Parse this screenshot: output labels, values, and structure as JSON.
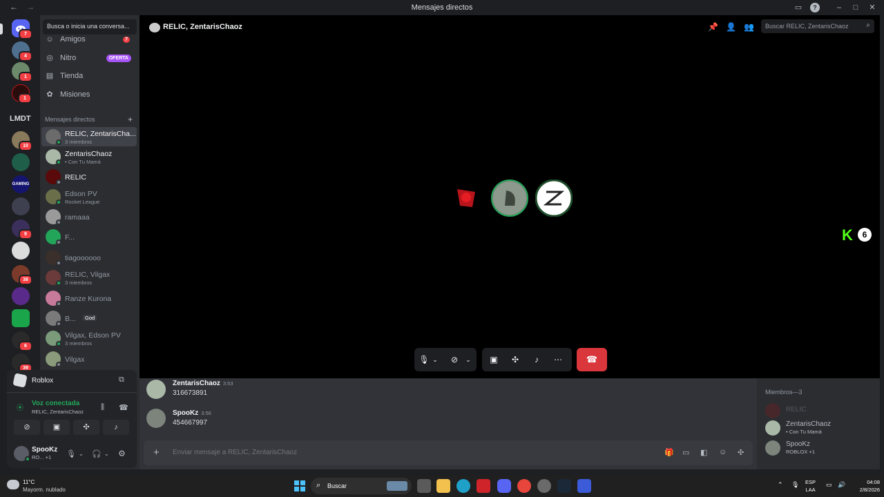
{
  "window": {
    "title": "Mensajes directos"
  },
  "sidebar": {
    "search_placeholder": "Busca o inicia una conversa...",
    "nav": [
      {
        "label": "Amigos",
        "badge": "7"
      },
      {
        "label": "Nitro",
        "badge": "OFERTA"
      },
      {
        "label": "Tienda"
      },
      {
        "label": "Misiones"
      }
    ],
    "dm_header": "Mensajes directos",
    "dms": [
      {
        "name": "RELIC, ZentarisCha...",
        "sub": "3 miembros"
      },
      {
        "name": "ZentarisChaoz",
        "sub": "• Con Tu Mamá"
      },
      {
        "name": "RELIC",
        "sub": ""
      },
      {
        "name": "Edson PV",
        "sub": "Rocket League"
      },
      {
        "name": "ramaaa",
        "sub": ""
      },
      {
        "name": "F...",
        "sub": ""
      },
      {
        "name": "tiagoooooo",
        "sub": ""
      },
      {
        "name": "RELIC, Vilgax",
        "sub": "3 miembros"
      },
      {
        "name": "Ranze Kurona",
        "sub": ""
      },
      {
        "name": "B...",
        "sub": "God"
      },
      {
        "name": "Vilgax, Edson PV",
        "sub": "3 miembros"
      },
      {
        "name": "Vilgax",
        "sub": ""
      }
    ],
    "server_label": "LMDT",
    "server_badges": [
      "7",
      "4",
      "1",
      "1",
      "10",
      "9",
      "38",
      "6",
      "39"
    ]
  },
  "activity": {
    "game": "Roblox"
  },
  "voice": {
    "status": "Voz conectada",
    "channel": "RELIC, ZentarisChaoz"
  },
  "user": {
    "name": "SpooKz",
    "status": "RO... +1"
  },
  "channel": {
    "title": "RELIC, ZentarisChaoz",
    "search_placeholder": "Buscar RELIC, ZentarisChaoz"
  },
  "messages": [
    {
      "author": "ZentarisChaoz",
      "time": "3:53",
      "content": "316673891"
    },
    {
      "author": "SpooKz",
      "time": "3:56",
      "content": "454667997"
    }
  ],
  "composer": {
    "placeholder": "Enviar mensaje a RELIC, ZentarisChaoz"
  },
  "members": {
    "header": "Miembros—3",
    "list": [
      {
        "name": "RELIC",
        "sub": ""
      },
      {
        "name": "ZentarisChaoz",
        "sub": "• Con Tu Mamá"
      },
      {
        "name": "SpooKz",
        "sub": "ROBLOX +1"
      }
    ]
  },
  "taskbar": {
    "temp": "11°C",
    "weather": "Mayorm. nublado",
    "search": "Buscar",
    "lang1": "ESP",
    "lang2": "LAA",
    "time": "04:08",
    "date": "2/8/2026"
  },
  "colors": {
    "accent": "#5865f2",
    "online": "#23a559",
    "danger": "#da373c",
    "kick": "#53fc18"
  }
}
